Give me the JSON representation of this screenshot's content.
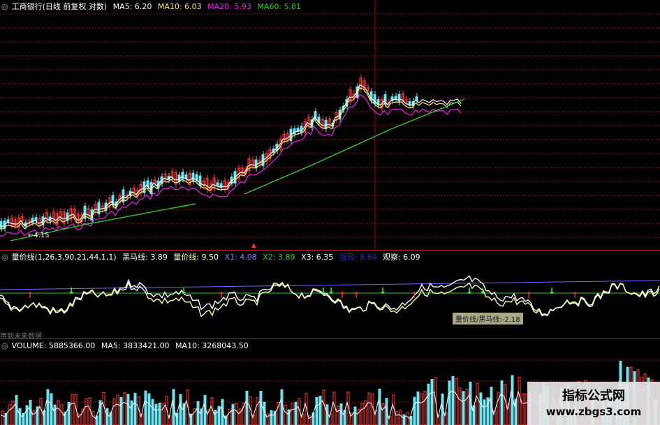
{
  "colors": {
    "background": "#000000",
    "grid_red": "#8a0f16",
    "separator": "#b4141e",
    "candle_up": "#ff3c3c",
    "candle_down": "#6fe4ef",
    "ma5": "#ffffff",
    "ma10": "#ffe66e",
    "ma20": "#e62ae6",
    "ma60": "#37c837",
    "indicator_line": "#ffffb0",
    "indicator_flat": "#ffffff",
    "indicator_blue": "#6a6aff",
    "indicator_green": "#37c837",
    "arrow_up": "#ff3030",
    "arrow_down": "#3cff3c"
  },
  "price_header": {
    "title": "工商银行(日线 前复权 对数)",
    "ma5": "MA5: 6.20",
    "ma10": "MA10: 6.03",
    "ma20": "MA20: 5.93",
    "ma60": "MA60: 5.81",
    "low_label": "←4.15"
  },
  "indicator_header": {
    "title": "量价线(1,26,3,90,21,44,1,1)",
    "heima": "黑马线: 3.89",
    "liangjia": "量价线: 9.50",
    "x1": "X1: 4.08",
    "x2": "X2: 3.89",
    "x3": "X3: 6.35",
    "blurred": "强弱: 8.64",
    "guancha": "观察: 6.09",
    "tooltip": "量价线/黑马线:-2.18",
    "future_note": "用到未来数据"
  },
  "volume_header": {
    "volume": "VOLUME: 5885366.00",
    "ma5": "MA5: 3833421.00",
    "ma10": "MA10: 3268043.50"
  },
  "icons": {
    "pane_toggle": "circle-dot-icon",
    "arrow_up": "red-up-arrow-icon",
    "arrow_down": "green-down-arrow-icon",
    "current_marker": "red-marker-icon"
  },
  "watermark": {
    "title": "指标公式网",
    "url": "www.zbgs3.com"
  }
}
